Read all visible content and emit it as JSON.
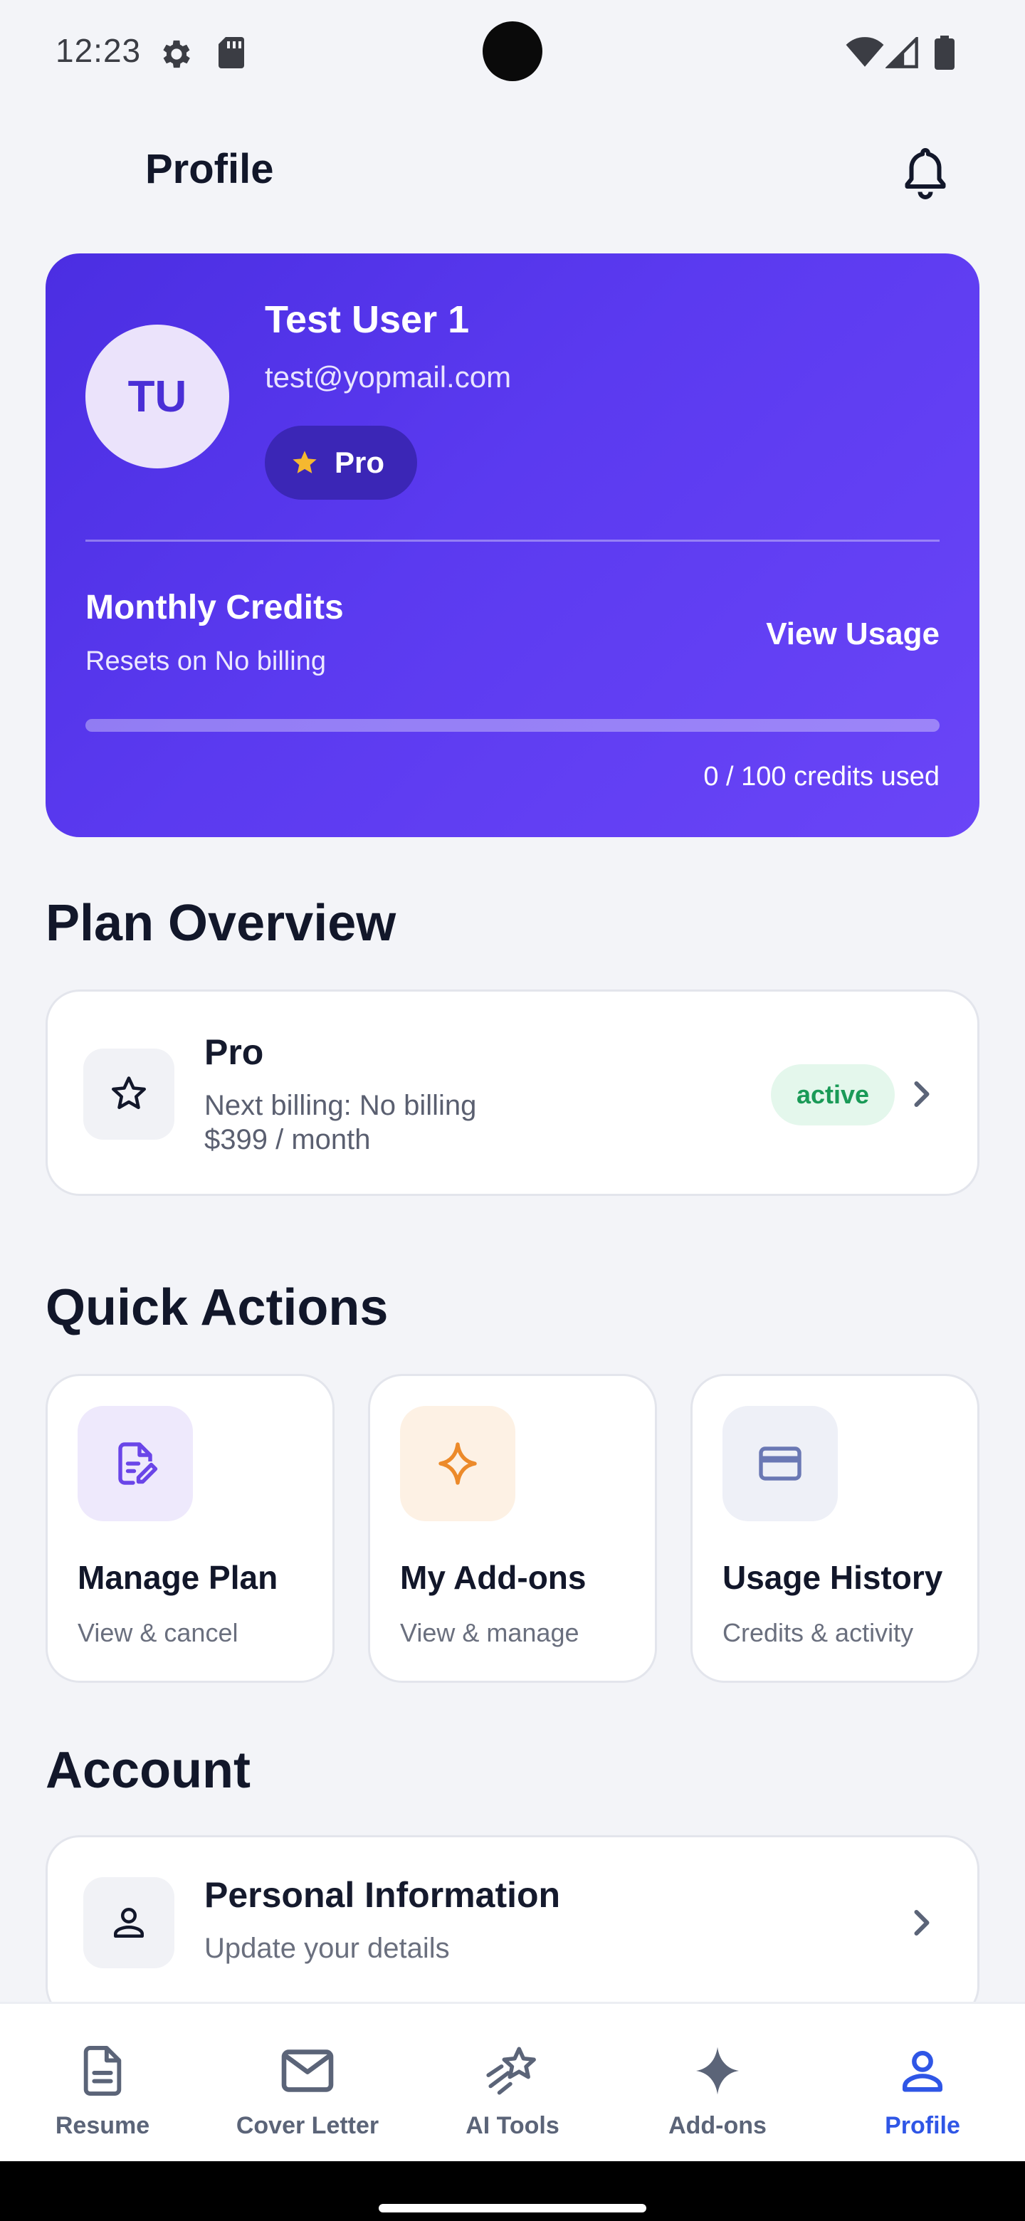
{
  "status_bar": {
    "time": "12:23"
  },
  "header": {
    "title": "Profile"
  },
  "profile": {
    "initials": "TU",
    "name": "Test User 1",
    "email": "test@yopmail.com",
    "plan_badge": "Pro",
    "credits_title": "Monthly Credits",
    "credits_reset": "Resets on No billing",
    "view_usage": "View Usage",
    "credits_used_text": "0 / 100 credits used",
    "credits_used_fraction": 0
  },
  "plan_overview": {
    "section_title": "Plan Overview",
    "name": "Pro",
    "next_billing": "Next billing: No billing",
    "price": "$399 / month",
    "status": "active"
  },
  "quick_actions": {
    "section_title": "Quick Actions",
    "items": [
      {
        "title": "Manage Plan",
        "subtitle": "View & cancel",
        "icon": "edit-document-icon",
        "icon_bg": "#eee9fc",
        "icon_color": "#6a45e8"
      },
      {
        "title": "My Add-ons",
        "subtitle": "View & manage",
        "icon": "sparkle-icon",
        "icon_bg": "#fdf1e4",
        "icon_color": "#ec8a2a"
      },
      {
        "title": "Usage History",
        "subtitle": "Credits & activity",
        "icon": "credit-card-icon",
        "icon_bg": "#eef0f7",
        "icon_color": "#6a78b4"
      }
    ]
  },
  "account": {
    "section_title": "Account",
    "items": [
      {
        "title": "Personal Information",
        "subtitle": "Update your details",
        "icon": "person-icon"
      }
    ]
  },
  "bottom_nav": {
    "items": [
      {
        "label": "Resume",
        "icon": "document-icon"
      },
      {
        "label": "Cover Letter",
        "icon": "mail-icon"
      },
      {
        "label": "AI Tools",
        "icon": "stars-icon"
      },
      {
        "label": "Add-ons",
        "icon": "sparkle-icon"
      },
      {
        "label": "Profile",
        "icon": "person-icon"
      }
    ],
    "active": "Profile",
    "active_color": "#2f56e6"
  },
  "colors": {
    "brand": "#5b3af0",
    "success": "#1a9a57"
  }
}
